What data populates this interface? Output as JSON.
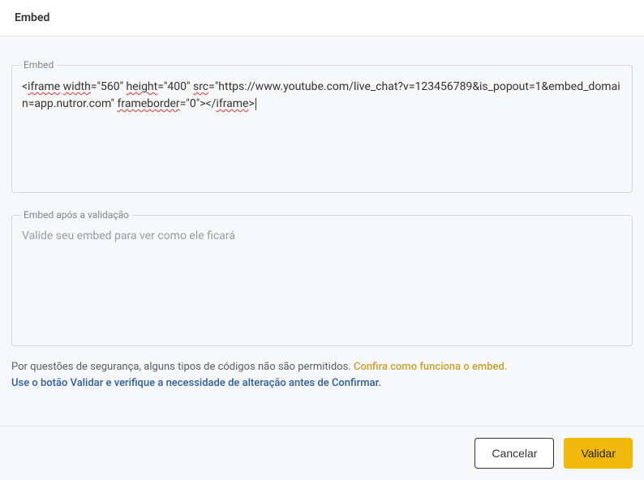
{
  "header": {
    "title": "Embed"
  },
  "embedField": {
    "legend": "Embed",
    "value": "<iframe width=\"560\" height=\"400\" src=\"https://www.youtube.com/live_chat?v=123456789&is_popout=1&embed_domain=app.nutror.com\" frameborder=\"0\"></iframe>",
    "segments": [
      {
        "t": "<",
        "u": false
      },
      {
        "t": "iframe",
        "u": true
      },
      {
        "t": " ",
        "u": false
      },
      {
        "t": "width",
        "u": true
      },
      {
        "t": "=\"560\" ",
        "u": false
      },
      {
        "t": "height",
        "u": true
      },
      {
        "t": "=\"400\" ",
        "u": false
      },
      {
        "t": "src",
        "u": true
      },
      {
        "t": "=\"https://www.youtube.com/live_chat?v=123456789&is_popout=1&embed_domain=app.nutror.com\" ",
        "u": false
      },
      {
        "t": "frameborder",
        "u": true
      },
      {
        "t": "=\"0\"></",
        "u": false
      },
      {
        "t": "iframe",
        "u": true
      },
      {
        "t": ">",
        "u": false
      }
    ]
  },
  "validationField": {
    "legend": "Embed após a validação",
    "placeholder": "Valide seu embed para ver como ele ficará",
    "value": ""
  },
  "notes": {
    "line1_plain": "Por questões de segurança, alguns tipos de códigos não são permitidos. ",
    "line1_link": "Confira como funciona o embed.",
    "line2": "Use o botão Validar e verifique a necessidade de alteração antes de Confirmar."
  },
  "footer": {
    "cancel": "Cancelar",
    "validate": "Validar"
  }
}
